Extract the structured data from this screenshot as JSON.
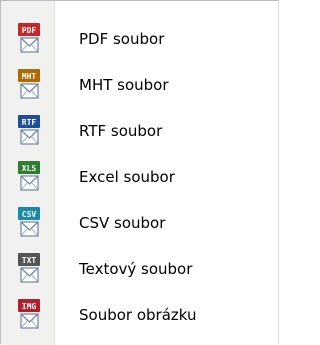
{
  "menu": {
    "items": [
      {
        "label": "PDF soubor",
        "icon": "pdf-mail-icon",
        "badge": "PDF",
        "badge_color": "#c62828"
      },
      {
        "label": "MHT soubor",
        "icon": "mht-mail-icon",
        "badge": "MHT",
        "badge_color": "#b26a00"
      },
      {
        "label": "RTF soubor",
        "icon": "rtf-mail-icon",
        "badge": "RTF",
        "badge_color": "#1f4e9a"
      },
      {
        "label": "Excel soubor",
        "icon": "excel-mail-icon",
        "badge": "XLS",
        "badge_color": "#2e7d32"
      },
      {
        "label": "CSV soubor",
        "icon": "csv-mail-icon",
        "badge": "CSV",
        "badge_color": "#1b8aa8"
      },
      {
        "label": "Textový soubor",
        "icon": "txt-mail-icon",
        "badge": "TXT",
        "badge_color": "#555555"
      },
      {
        "label": "Soubor obrázku",
        "icon": "img-mail-icon",
        "badge": "IMG",
        "badge_color": "#b31f2d"
      }
    ]
  }
}
